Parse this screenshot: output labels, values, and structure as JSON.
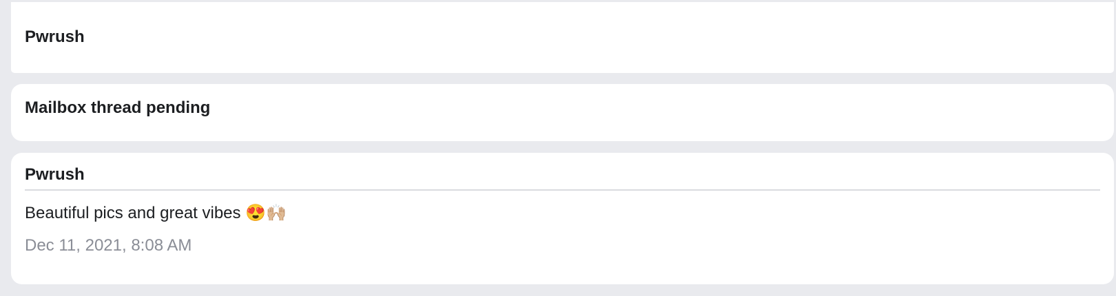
{
  "threads": [
    {
      "title": "Pwrush"
    },
    {
      "title": "Mailbox thread pending"
    },
    {
      "title": "Pwrush",
      "message": "Beautiful pics and great vibes 😍🙌🏼",
      "timestamp": "Dec 11, 2021, 8:08 AM"
    }
  ]
}
